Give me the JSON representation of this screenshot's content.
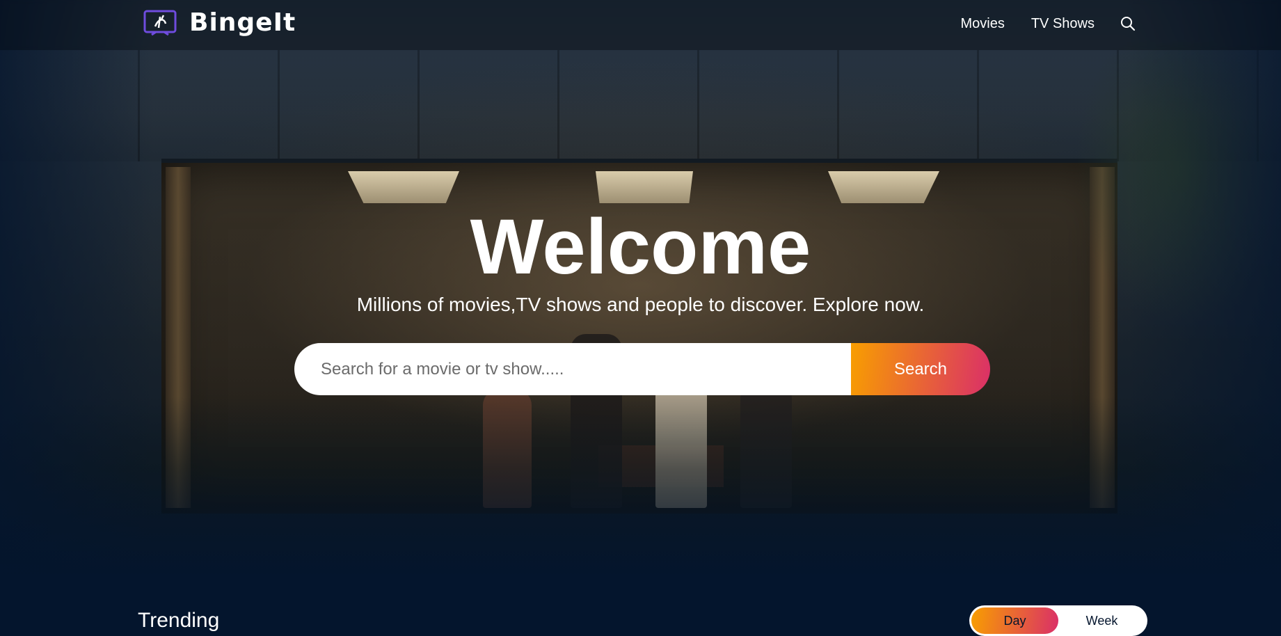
{
  "header": {
    "brand": "BingeIt",
    "brand_icon": "tv-logo-icon",
    "nav": [
      {
        "label": "Movies"
      },
      {
        "label": "TV Shows"
      }
    ],
    "search_icon": "search-icon"
  },
  "hero": {
    "title": "Welcome",
    "subtitle": "Millions of movies,TV shows and people to discover. Explore now.",
    "search": {
      "placeholder": "Search for a movie or tv show.....",
      "value": "",
      "button_label": "Search"
    }
  },
  "trending": {
    "title": "Trending",
    "tabs": [
      {
        "label": "Day",
        "active": true
      },
      {
        "label": "Week",
        "active": false
      }
    ]
  },
  "colors": {
    "background": "#04152d",
    "accent_gradient_start": "#f89e00",
    "accent_gradient_end": "#da2f68",
    "logo_purple": "#6f4cde"
  }
}
